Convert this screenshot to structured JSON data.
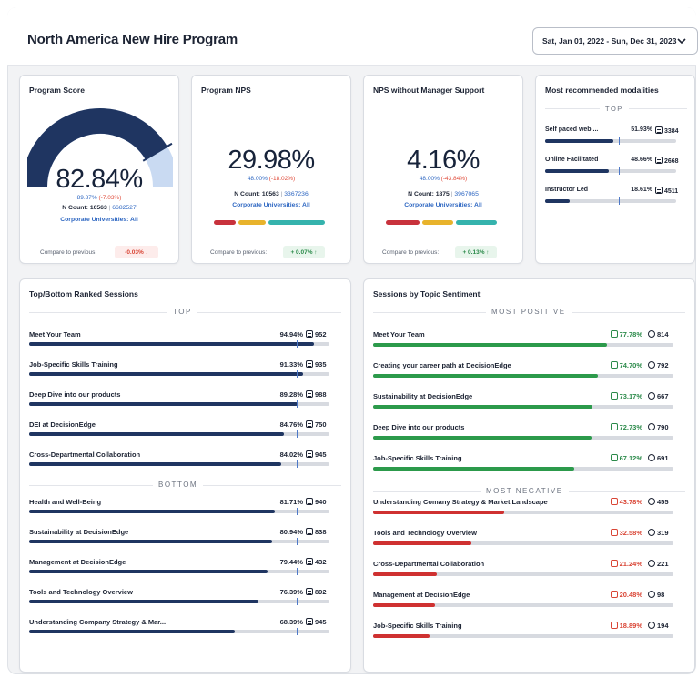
{
  "header": {
    "title": "North America New Hire Program",
    "date_range": "Sat, Jan 01, 2022 - Sun, Dec 31, 2023"
  },
  "colors": {
    "navy": "#1f3561",
    "gauge_light": "#c9daf2",
    "positive": "#2c9a4b",
    "negative": "#cf3131",
    "marker": "#4c78c8",
    "track": "#d7dae0",
    "nps_red": "#c8323c",
    "nps_yellow": "#e8b32c",
    "nps_teal": "#35b3ad"
  },
  "program_score": {
    "title": "Program Score",
    "value": "82.84%",
    "gauge_fraction": 0.8284,
    "prev_value": "89.87%",
    "delta": "(-7.03%)",
    "n_label": "N Count: 10563",
    "sep": "|",
    "n_link": "6682527",
    "corp": "Corporate Universities: All",
    "compare_label": "Compare to previous:",
    "compare_value": "-0.03%",
    "compare_arrow": "↓"
  },
  "program_nps": {
    "title": "Program NPS",
    "value": "29.98%",
    "prev_value": "48.00%",
    "delta": "(-18.02%)",
    "n_label": "N Count: 10563",
    "sep": "|",
    "n_link": "3367236",
    "corp": "Corporate Universities: All",
    "compare_label": "Compare to previous:",
    "compare_value": "+ 0.07%",
    "compare_arrow": "↑"
  },
  "nps_no_manager": {
    "title": "NPS without Manager Support",
    "value": "4.16%",
    "prev_value": "48.00%",
    "delta": "(-43.84%)",
    "n_label": "N Count: 1875",
    "sep": "|",
    "n_link": "3967065",
    "corp": "Corporate Universities: All",
    "compare_label": "Compare to previous:",
    "compare_value": "+ 0.13%",
    "compare_arrow": "↑"
  },
  "modalities": {
    "title": "Most recommended modalities",
    "section": "TOP",
    "items": [
      {
        "name": "Self paced web ...",
        "pct": "51.93%",
        "count": "3384",
        "fill": 0.5193,
        "marker": 0.56
      },
      {
        "name": "Online Facilitated",
        "pct": "48.66%",
        "count": "2668",
        "fill": 0.4866,
        "marker": 0.56
      },
      {
        "name": "Instructor Led",
        "pct": "18.61%",
        "count": "4511",
        "fill": 0.1861,
        "marker": 0.56
      }
    ]
  },
  "ranked": {
    "title": "Top/Bottom Ranked Sessions",
    "top_label": "TOP",
    "bottom_label": "BOTTOM",
    "top": [
      {
        "name": "Meet Your Team",
        "pct": "94.94%",
        "count": "952",
        "fill": 0.9494
      },
      {
        "name": "Job-Specific Skills Training",
        "pct": "91.33%",
        "count": "935",
        "fill": 0.9133
      },
      {
        "name": "Deep Dive into our products",
        "pct": "89.28%",
        "count": "988",
        "fill": 0.8928
      },
      {
        "name": "DEI at DecisionEdge",
        "pct": "84.76%",
        "count": "750",
        "fill": 0.8476
      },
      {
        "name": "Cross-Departmental Collaboration",
        "pct": "84.02%",
        "count": "945",
        "fill": 0.8402
      }
    ],
    "bottom": [
      {
        "name": "Health and Well-Being",
        "pct": "81.71%",
        "count": "940",
        "fill": 0.8171
      },
      {
        "name": "Sustainability at DecisionEdge",
        "pct": "80.94%",
        "count": "838",
        "fill": 0.8094
      },
      {
        "name": "Management at DecisionEdge",
        "pct": "79.44%",
        "count": "432",
        "fill": 0.7944
      },
      {
        "name": "Tools and Technology Overview",
        "pct": "76.39%",
        "count": "892",
        "fill": 0.7639
      },
      {
        "name": "Understanding Company Strategy & Mar...",
        "pct": "68.39%",
        "count": "945",
        "fill": 0.6839
      }
    ],
    "marker": 0.89
  },
  "sentiment": {
    "title": "Sessions by Topic Sentiment",
    "positive_label": "MOST POSITIVE",
    "negative_label": "MOST NEGATIVE",
    "positive": [
      {
        "name": "Meet Your Team",
        "pct": "77.78%",
        "count": "814",
        "fill": 0.7778
      },
      {
        "name": "Creating your career path at DecisionEdge",
        "pct": "74.70%",
        "count": "792",
        "fill": 0.747
      },
      {
        "name": "Sustainability at DecisionEdge",
        "pct": "73.17%",
        "count": "667",
        "fill": 0.7317
      },
      {
        "name": "Deep Dive into our products",
        "pct": "72.73%",
        "count": "790",
        "fill": 0.7273
      },
      {
        "name": "Job-Specific Skills Training",
        "pct": "67.12%",
        "count": "691",
        "fill": 0.6712
      }
    ],
    "negative": [
      {
        "name": "Understanding Comany Strategy & Market Landscape",
        "pct": "43.78%",
        "count": "455",
        "fill": 0.4378
      },
      {
        "name": "Tools and Technology Overview",
        "pct": "32.58%",
        "count": "319",
        "fill": 0.3258
      },
      {
        "name": "Cross-Departmental Collaboration",
        "pct": "21.24%",
        "count": "221",
        "fill": 0.2124
      },
      {
        "name": "Management at DecisionEdge",
        "pct": "20.48%",
        "count": "98",
        "fill": 0.2048
      },
      {
        "name": "Job-Specific Skills Training",
        "pct": "18.89%",
        "count": "194",
        "fill": 0.1889
      }
    ]
  }
}
